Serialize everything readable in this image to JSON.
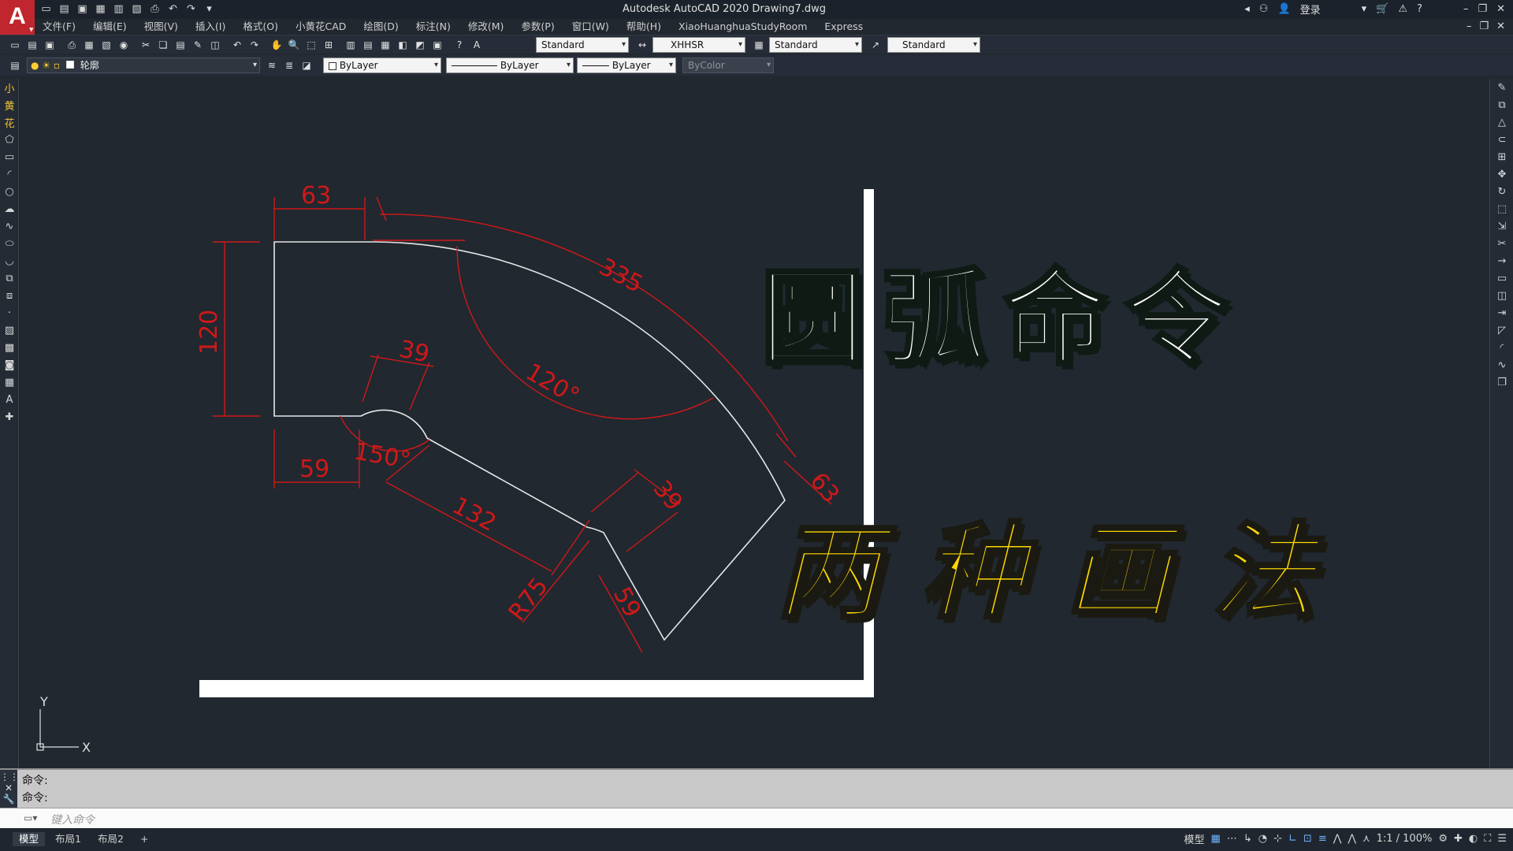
{
  "app": {
    "logo_letter": "A",
    "title": "Autodesk AutoCAD 2020    Drawing7.dwg",
    "signin": "登录"
  },
  "menu": [
    "文件(F)",
    "编辑(E)",
    "视图(V)",
    "插入(I)",
    "格式(O)",
    "小黄花CAD",
    "绘图(D)",
    "标注(N)",
    "修改(M)",
    "参数(P)",
    "窗口(W)",
    "帮助(H)",
    "XiaoHuanghuaStudyRoom",
    "Express"
  ],
  "toolbar": {
    "text_style": "Standard",
    "dim_style": "XHHSR",
    "table_style": "Standard",
    "mleader_style": "Standard"
  },
  "properties": {
    "layer": "轮廓",
    "color": "ByLayer",
    "linetype": "ByLayer",
    "lineweight": "ByLayer",
    "plotstyle": "ByColor"
  },
  "drawing": {
    "dims": {
      "d63_top": "63",
      "d335": "335",
      "d120": "120",
      "d39_a": "39",
      "d120deg": "120°",
      "d150deg": "150°",
      "d59_bottom": "59",
      "d132": "132",
      "d39_b": "39",
      "d63_right": "63",
      "r75": "R75",
      "d59_right": "59"
    },
    "ucs": {
      "x": "X",
      "y": "Y"
    }
  },
  "overlay": {
    "line1": "圆弧命令",
    "line2": "两种画法",
    "line1_color": "#ffffff",
    "line2_color": "#ffd800"
  },
  "command": {
    "history": [
      "命令:",
      "命令:"
    ],
    "placeholder": "键入命令"
  },
  "status": {
    "tabs": [
      "模型",
      "布局1",
      "布局2"
    ],
    "add_tab": "+",
    "mode_label": "模型",
    "scale": "1:1 / 100%"
  },
  "colors": {
    "dimension": "#d01818",
    "geometry": "#e6e6e6",
    "background": "#212830"
  }
}
